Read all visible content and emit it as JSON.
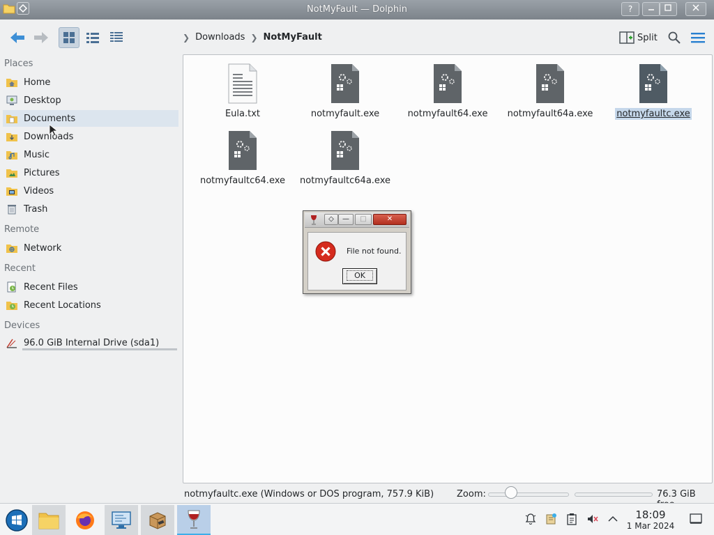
{
  "window": {
    "title": "NotMyFault — Dolphin",
    "help_label": "?"
  },
  "toolbar": {
    "breadcrumb": [
      "Downloads",
      "NotMyFault"
    ],
    "split_label": "Split"
  },
  "sidebar": {
    "sections": [
      {
        "heading": "Places",
        "items": [
          "Home",
          "Desktop",
          "Documents",
          "Downloads",
          "Music",
          "Pictures",
          "Videos",
          "Trash"
        ]
      },
      {
        "heading": "Remote",
        "items": [
          "Network"
        ]
      },
      {
        "heading": "Recent",
        "items": [
          "Recent Files",
          "Recent Locations"
        ]
      },
      {
        "heading": "Devices",
        "items": [
          "96.0 GiB Internal Drive (sda1)"
        ]
      }
    ],
    "hovered_item": "Documents"
  },
  "files": [
    {
      "name": "Eula.txt",
      "type": "text",
      "icon": "text-file-icon"
    },
    {
      "name": "notmyfault.exe",
      "type": "exe",
      "icon": "exe-file-icon"
    },
    {
      "name": "notmyfault64.exe",
      "type": "exe",
      "icon": "exe-file-icon"
    },
    {
      "name": "notmyfault64a.exe",
      "type": "exe",
      "icon": "exe-file-icon"
    },
    {
      "name": "notmyfaultc.exe",
      "type": "exe",
      "icon": "exe-file-icon",
      "selected": true
    },
    {
      "name": "notmyfaultc64.exe",
      "type": "exe",
      "icon": "exe-file-icon"
    },
    {
      "name": "notmyfaultc64a.exe",
      "type": "exe",
      "icon": "exe-file-icon"
    }
  ],
  "status": {
    "selection_info": "notmyfaultc.exe (Windows or DOS program, 757.9 KiB)",
    "zoom_label": "Zoom:",
    "free_space": "76.3 GiB free"
  },
  "dialog": {
    "message": "File not found.",
    "ok_label": "OK",
    "icon": "error-icon"
  },
  "taskbar": {
    "time": "18:09",
    "date": "1 Mar 2024",
    "apps": [
      "application-launcher",
      "dolphin",
      "firefox",
      "system-settings",
      "package-manager",
      "wine"
    ]
  },
  "colors": {
    "accent": "#3daee9",
    "selection": "#c5d7ea",
    "error": "#d52b1e"
  }
}
